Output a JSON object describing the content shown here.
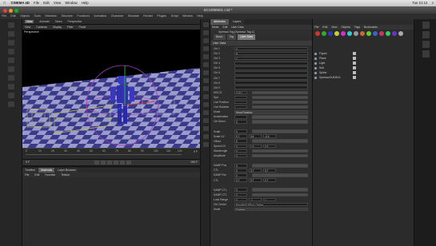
{
  "menubar": {
    "app_name": "CINEMA 4D",
    "items": [
      "File",
      "Edit",
      "View",
      "Window",
      "Help"
    ],
    "right": [
      "Tue 21:12"
    ]
  },
  "window": {
    "title": "SCU090501.c4d *"
  },
  "main_menu": [
    "File",
    "Edit",
    "Objects",
    "Tools",
    "Selection",
    "Structure",
    "Functions",
    "Animation",
    "Character",
    "Simulate",
    "Render",
    "Plugins",
    "Script",
    "Window",
    "Help"
  ],
  "toolbar": [
    "View",
    "Animate",
    "Takes",
    "Perspective"
  ],
  "viewport_menu": [
    "View",
    "Cameras",
    "Display",
    "Filter",
    "Panel"
  ],
  "viewport": {
    "label": "Perspective"
  },
  "timeline": {
    "ticks": [
      "0",
      "10",
      "20",
      "30",
      "40",
      "50",
      "60",
      "70",
      "80",
      "90",
      "100",
      "110",
      "120"
    ],
    "frame": "0 F"
  },
  "playbar": {
    "start": "0 F",
    "end": "150 F",
    "progress": 0.0
  },
  "materials": {
    "tabs": [
      "Timeline",
      "Materials",
      "Layer Browser"
    ],
    "active_tab": 1,
    "menu": [
      "File",
      "Edit",
      "Function",
      "Texture"
    ]
  },
  "attributes": {
    "tabs": [
      "Attributes",
      "Layers"
    ],
    "menu": [
      "Mode",
      "Edit",
      "User Data"
    ],
    "object_title": "Xpresso Tag [Xpresso Tag.1]",
    "subtabs": [
      "Basic",
      "Tag",
      "User Data"
    ],
    "section": "User Data",
    "rows": [
      {
        "label": "Ctrl 1",
        "value": "A",
        "kind": "wide"
      },
      {
        "label": "Ctrl 2",
        "value": "B",
        "kind": "wide"
      },
      {
        "label": "Ctrl 3",
        "value": "C",
        "kind": "wide"
      },
      {
        "label": "Ctrl 4",
        "value": "",
        "kind": "wide"
      },
      {
        "label": "Ctrl 5",
        "value": "",
        "kind": "wide"
      },
      {
        "label": "Ctrl 6",
        "value": "",
        "kind": "wide"
      },
      {
        "label": "Ctrl 7",
        "value": "",
        "kind": "wide"
      },
      {
        "label": "Ctrl 8",
        "value": "",
        "kind": "wide"
      },
      {
        "label": "Ctrl 9",
        "value": "",
        "kind": "wide"
      },
      {
        "label": "MOCG",
        "value": "0.001",
        "kind": "sm"
      },
      {
        "label": "Spd",
        "value": "",
        "kind": "sm"
      },
      {
        "label": "Live Position",
        "value": "",
        "kind": "sm"
      },
      {
        "label": "Live Rotation",
        "value": "",
        "kind": "sm"
      },
      {
        "label": "Mode",
        "value": "Head Rotation",
        "kind": "drop"
      },
      {
        "label": "Acceleration",
        "value": "",
        "kind": "sm"
      },
      {
        "label": "Ctrl Direct",
        "value": "0",
        "kind": "sm"
      },
      {
        "label": "",
        "value": "",
        "kind": "none"
      },
      {
        "label": "Scale",
        "value": "0",
        "kind": "sm"
      },
      {
        "label": "Scale UV",
        "value": "0.7",
        "v2": "0.4",
        "v3": "-0.4",
        "kind": "triple"
      },
      {
        "label": "Offset",
        "value": "0",
        "kind": "sm"
      },
      {
        "label": "Speed UV",
        "value": "0",
        "v2": "1.5",
        "v3": "0.5",
        "kind": "triple"
      },
      {
        "label": "Wavelength",
        "value": "0",
        "kind": "sm"
      },
      {
        "label": "Amplitude",
        "value": "0",
        "kind": "sm"
      },
      {
        "label": "",
        "value": "",
        "kind": "none"
      },
      {
        "label": "DAMP Pos",
        "value": "0",
        "kind": "sm"
      },
      {
        "label": "CTL",
        "value": "0",
        "v2": "0.7",
        "v3": "0.7",
        "kind": "triple"
      },
      {
        "label": "DAMP Rot",
        "value": "0",
        "kind": "sm"
      },
      {
        "label": "CTL",
        "value": "0.7",
        "v2": "0.7",
        "v3": "0.7",
        "kind": "triple"
      },
      {
        "label": "",
        "value": "",
        "kind": "none"
      },
      {
        "label": "DAMP CTL",
        "value": "0",
        "kind": "sm"
      },
      {
        "label": "DAMP CTL",
        "value": "0",
        "kind": "sm"
      },
      {
        "label": "Look Range",
        "value": "0",
        "v2": "-1",
        "v3": "1",
        "kind": "triple"
      },
      {
        "label": "Ctrl Center",
        "value": "Head/HULKEnd_Center",
        "kind": "wide"
      },
      {
        "label": "Mode",
        "value": "Custom",
        "kind": "drop"
      }
    ]
  },
  "object_manager": {
    "menu": [
      "File",
      "Edit",
      "View",
      "Objects",
      "Tags",
      "Bookmarks"
    ],
    "objects": [
      "Figure",
      "Plane",
      "Light",
      "Null",
      "Spline",
      "XpressoGUIDEv1"
    ]
  }
}
